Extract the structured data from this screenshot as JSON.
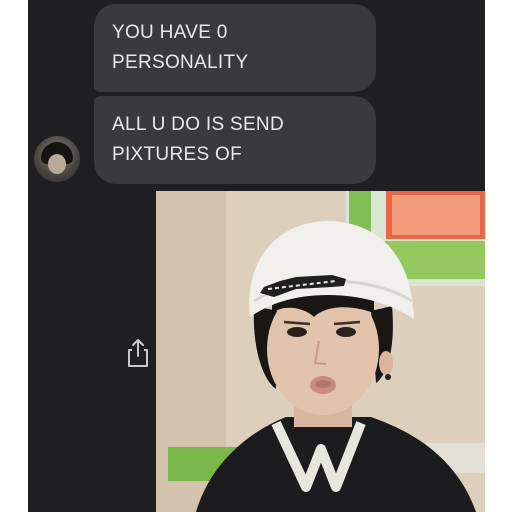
{
  "messages": [
    {
      "lines": [
        "YOU HAVE 0",
        "PERSONALITY"
      ]
    },
    {
      "lines": [
        "ALL U DO IS SEND",
        "PIXTURES OF"
      ]
    }
  ],
  "icons": {
    "avatar": "user-avatar",
    "share": "share-icon"
  },
  "attachment": {
    "type": "photo",
    "subject": "person in white beanie and black jacket"
  },
  "colors": {
    "chat_background": "#1f1f21",
    "bubble": "#3a3a3c",
    "bubble_text": "#e9e9eb"
  }
}
